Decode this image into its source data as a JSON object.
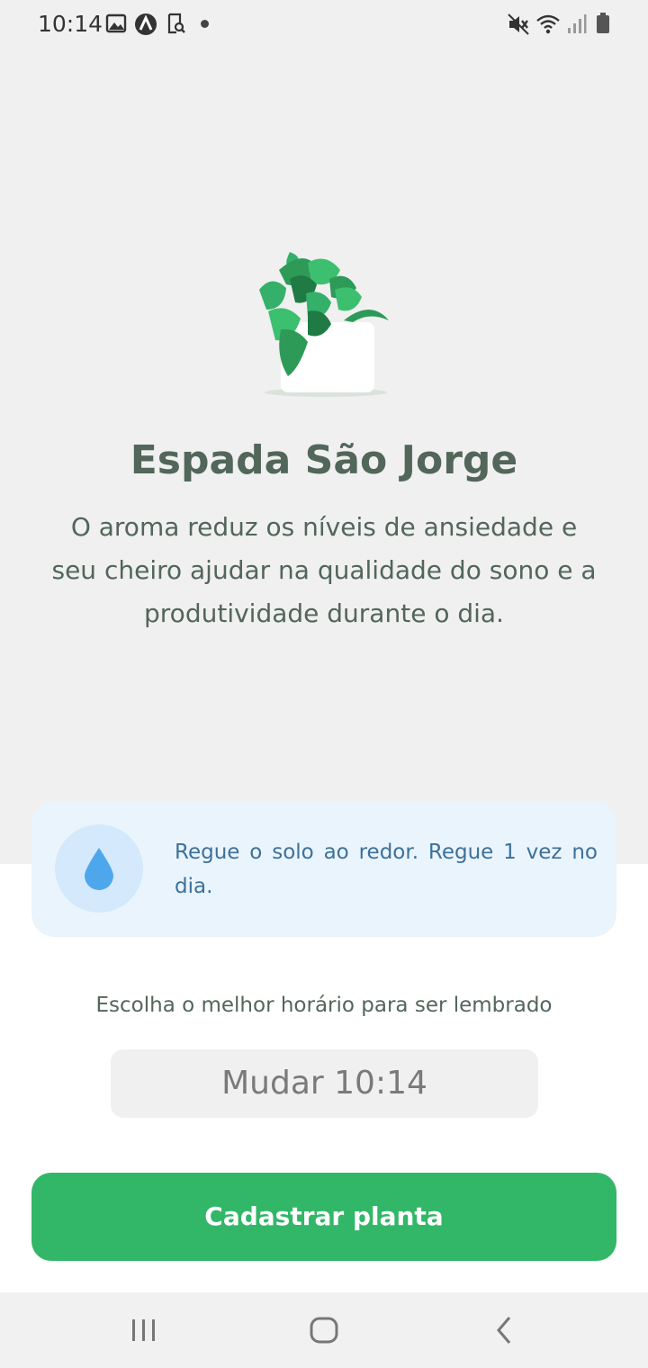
{
  "status_bar": {
    "time": "10:14",
    "left_icons": [
      "image-icon",
      "app-logo-icon",
      "search-doc-icon",
      "notification-dot"
    ],
    "right_icons": [
      "mute-icon",
      "wifi-icon",
      "signal-icon",
      "battery-icon"
    ]
  },
  "plant": {
    "name": "Espada São Jorge",
    "about": "O aroma reduz os níveis de ansiedade e seu cheiro ajudar na qualidade do sono e a produtividade durante o dia."
  },
  "tip": {
    "icon": "water-drop-icon",
    "text": "Regue o solo ao redor. Regue 1 vez no dia."
  },
  "schedule": {
    "label": "Escolha o melhor horário para ser lembrado",
    "button_label": "Mudar 10:14"
  },
  "actions": {
    "submit_label": "Cadastrar planta"
  },
  "colors": {
    "accent_green": "#32b768",
    "heading": "#52665a",
    "tip_background": "#eaf4fd",
    "tip_text": "#3d7199"
  },
  "nav_bar": {
    "buttons": [
      "recent-apps-icon",
      "home-icon",
      "back-icon"
    ]
  }
}
